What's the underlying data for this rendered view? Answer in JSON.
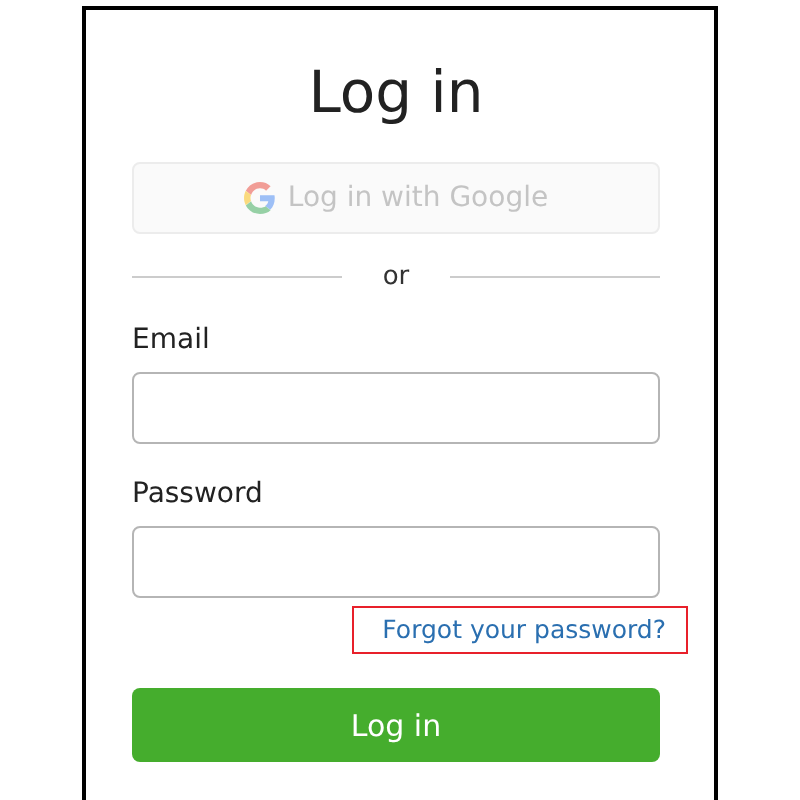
{
  "title": "Log in",
  "google_button": {
    "label": "Log in with Google",
    "disabled": true
  },
  "divider_text": "or",
  "fields": [
    {
      "label": "Email"
    },
    {
      "label": "Password"
    }
  ],
  "forgot_link": {
    "label": "Forgot your password?",
    "highlighted": true
  },
  "submit_button": {
    "label": "Log in"
  }
}
